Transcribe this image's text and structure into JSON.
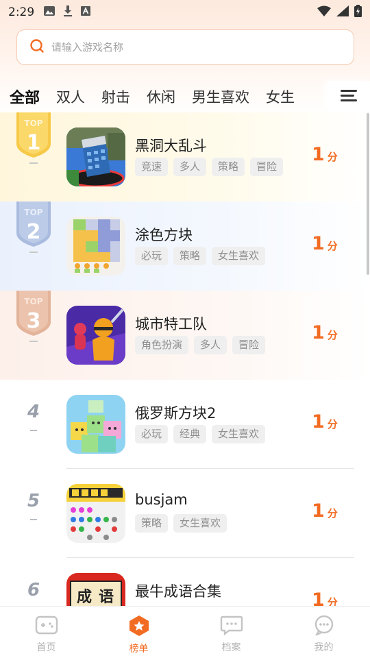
{
  "status_bar": {
    "time": "2:29"
  },
  "search": {
    "placeholder": "请输入游戏名称"
  },
  "tabs": [
    {
      "label": "全部",
      "active": true
    },
    {
      "label": "双人"
    },
    {
      "label": "射击"
    },
    {
      "label": "休闲"
    },
    {
      "label": "男生喜欢"
    },
    {
      "label": "女生"
    }
  ],
  "badge_text": "TOP",
  "games": [
    {
      "rank": "1",
      "title": "黑洞大乱斗",
      "tags": [
        "竞速",
        "多人",
        "策略",
        "冒险"
      ],
      "score": "1",
      "unit": "分"
    },
    {
      "rank": "2",
      "title": "涂色方块",
      "tags": [
        "必玩",
        "策略",
        "女生喜欢"
      ],
      "score": "1",
      "unit": "分"
    },
    {
      "rank": "3",
      "title": "城市特工队",
      "tags": [
        "角色扮演",
        "多人",
        "冒险"
      ],
      "score": "1",
      "unit": "分"
    },
    {
      "rank": "4",
      "title": "俄罗斯方块2",
      "tags": [
        "必玩",
        "经典",
        "女生喜欢"
      ],
      "score": "1",
      "unit": "分"
    },
    {
      "rank": "5",
      "title": "busjam",
      "tags": [
        "策略",
        "女生喜欢"
      ],
      "score": "1",
      "unit": "分"
    },
    {
      "rank": "6",
      "title": "最牛成语合集",
      "tags": [],
      "score": "1",
      "unit": "分",
      "thumb_text": [
        "成",
        "语"
      ]
    }
  ],
  "bottom_nav": [
    {
      "label": "首页",
      "icon": "gamepad-icon"
    },
    {
      "label": "榜单",
      "icon": "ranking-icon",
      "active": true
    },
    {
      "label": "档案",
      "icon": "archive-chat-icon"
    },
    {
      "label": "我的",
      "icon": "profile-chat-icon"
    }
  ],
  "colors": {
    "accent": "#f26b22",
    "gold": "#f7c948",
    "silver": "#a9bbde",
    "bronze": "#e3b39a"
  }
}
